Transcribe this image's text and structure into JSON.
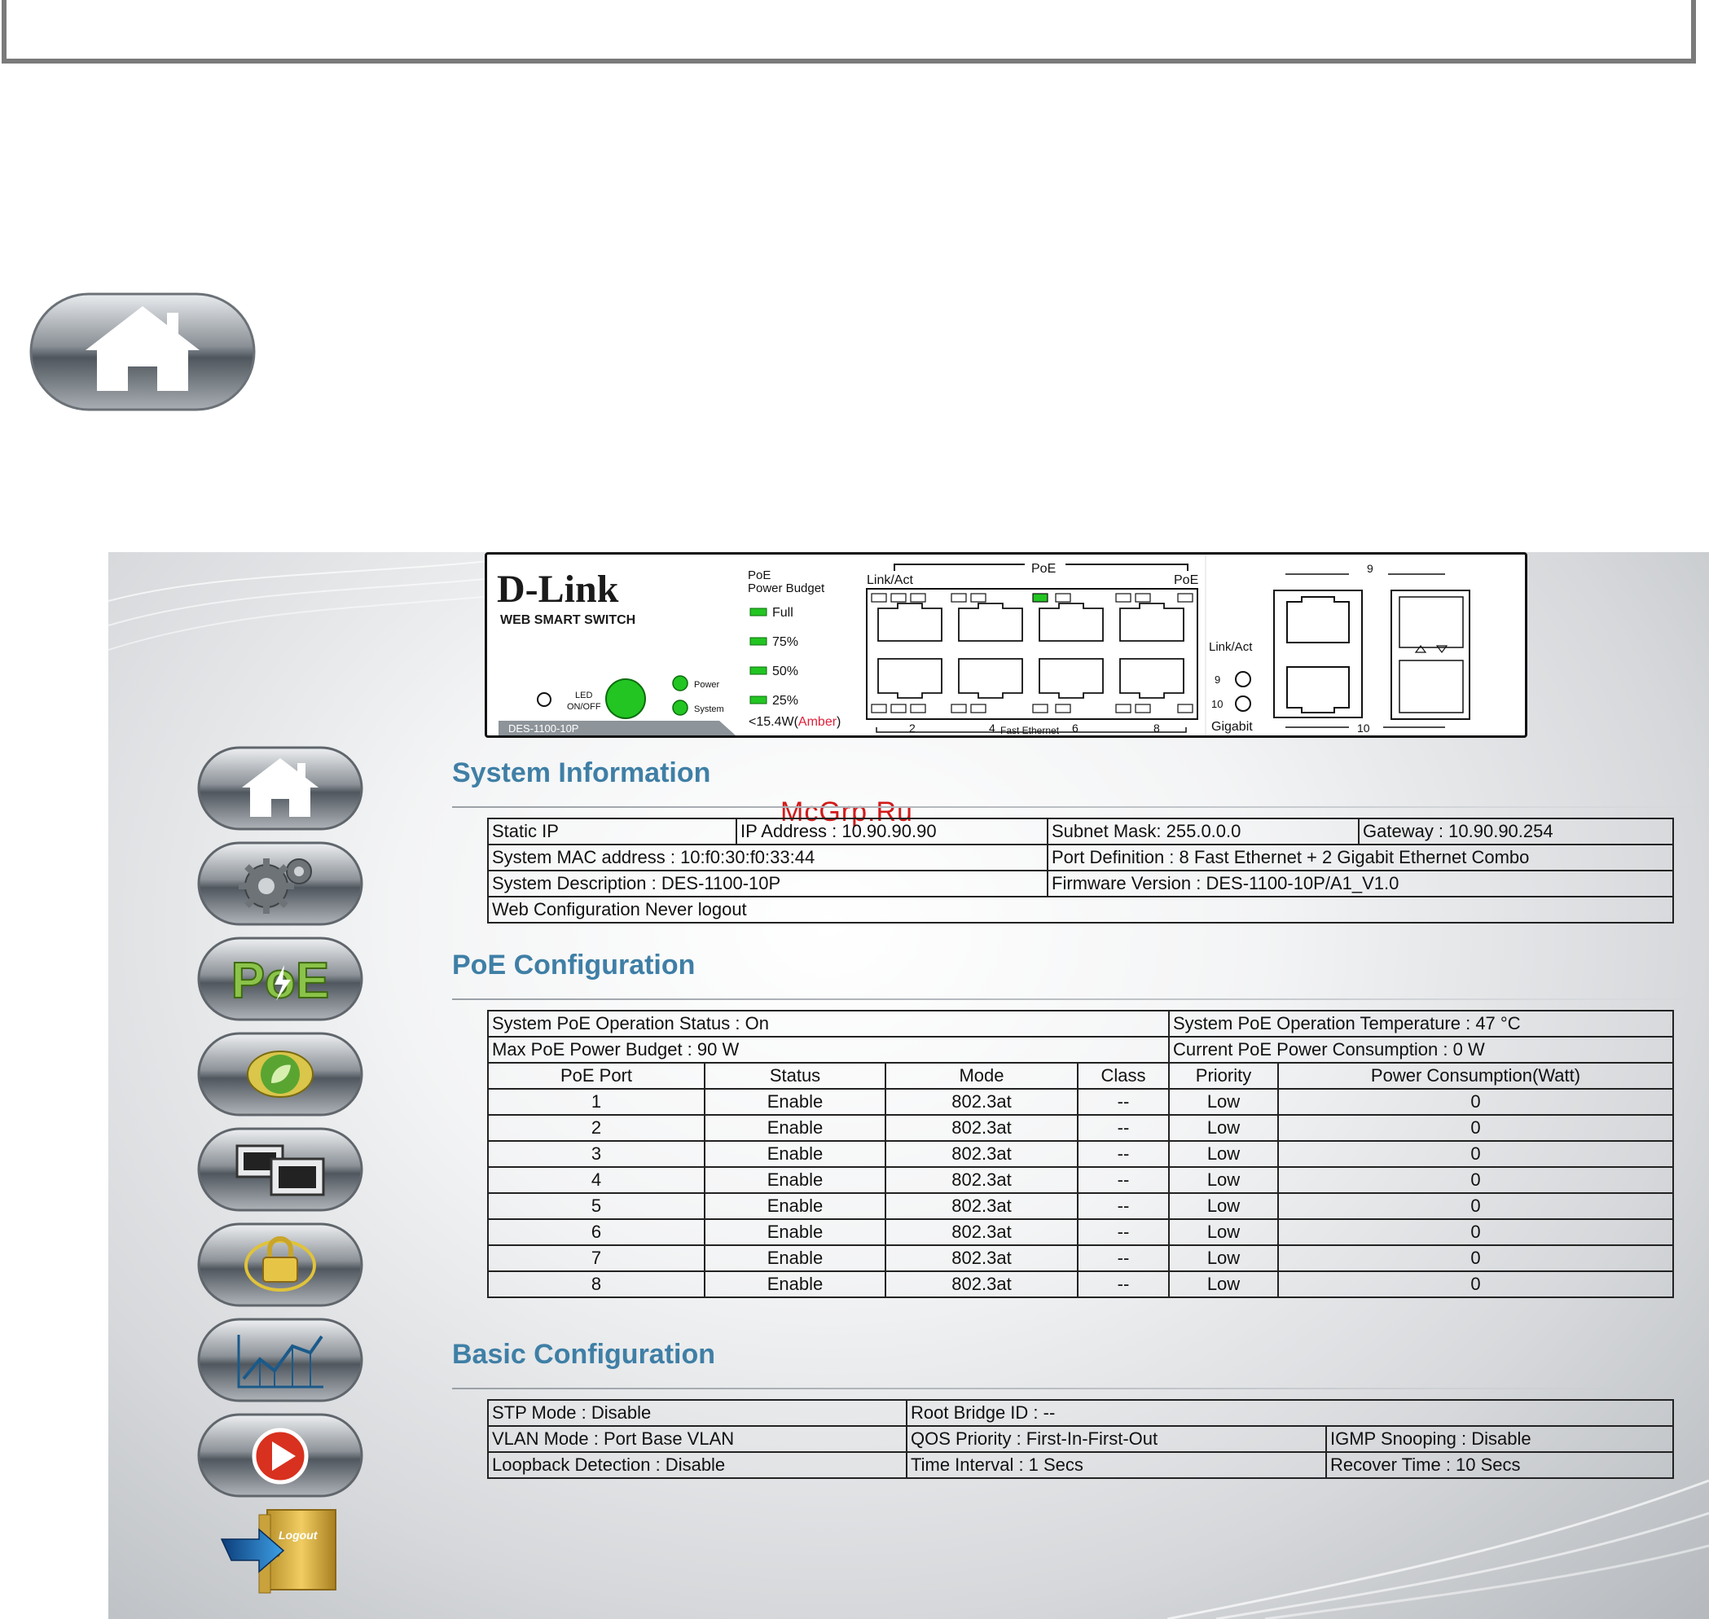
{
  "device": {
    "brand": "D-Link",
    "subtitle": "WEB SMART SWITCH",
    "model": "DES-1100-10P",
    "led_label_1": "LED",
    "led_label_2": "ON/OFF",
    "power_label": "Power",
    "system_label": "System",
    "poe_budget_label_1": "PoE",
    "poe_budget_label_2": "Power Budget",
    "budget_levels": [
      "Full",
      "75%",
      "50%",
      "25%"
    ],
    "budget_note": "<15.4W(",
    "budget_note_amber": "Amber",
    "budget_note_end": ")",
    "linkact_label": "Link/Act",
    "poe_label": "PoE",
    "poe_label_right": "PoE",
    "fast_ethernet_label": "Fast Ethernet",
    "port_numbers_bottom": [
      "2",
      "4",
      "6",
      "8"
    ],
    "gigabit_linkact": "Link/Act",
    "gigabit_led_9": "9",
    "gigabit_led_10": "10",
    "gigabit_label": "Gigabit",
    "combo_port_9": "9",
    "combo_port_10": "10",
    "active_poe_led_index": 2,
    "colors": {
      "led_green": "#22c522",
      "amber": "#e0203a"
    }
  },
  "sidebar": {
    "items": [
      {
        "name": "home",
        "icon": "home-icon"
      },
      {
        "name": "settings",
        "icon": "gears-icon"
      },
      {
        "name": "poe",
        "icon": "poe-icon"
      },
      {
        "name": "green",
        "icon": "leaf-icon"
      },
      {
        "name": "ports",
        "icon": "network-ports-icon"
      },
      {
        "name": "security",
        "icon": "lock-icon"
      },
      {
        "name": "monitoring",
        "icon": "chart-icon"
      },
      {
        "name": "tools",
        "icon": "play-icon"
      }
    ],
    "logout_label": "Logout"
  },
  "watermark": "McGrp.Ru",
  "system_info": {
    "title": "System Information",
    "static_ip": "Static IP",
    "ip_address": "IP Address : 10.90.90.90",
    "subnet_mask": "Subnet Mask: 255.0.0.0",
    "gateway": "Gateway : 10.90.90.254",
    "mac": "System MAC address : 10:f0:30:f0:33:44",
    "port_definition": "Port Definition : 8 Fast Ethernet + 2 Gigabit Ethernet Combo",
    "description": "System Description : DES-1100-10P",
    "firmware": "Firmware Version : DES-1100-10P/A1_V1.0",
    "web_config": "Web Configuration Never logout"
  },
  "poe_config": {
    "title": "PoE Configuration",
    "operation_status": "System PoE Operation Status : On",
    "temperature": "System PoE Operation Temperature : 47 °C",
    "max_budget": "Max PoE Power Budget : 90 W",
    "consumption": "Current PoE Power Consumption : 0 W",
    "headers": [
      "PoE Port",
      "Status",
      "Mode",
      "Class",
      "Priority",
      "Power Consumption(Watt)"
    ],
    "rows": [
      [
        "1",
        "Enable",
        "802.3at",
        "--",
        "Low",
        "0"
      ],
      [
        "2",
        "Enable",
        "802.3at",
        "--",
        "Low",
        "0"
      ],
      [
        "3",
        "Enable",
        "802.3at",
        "--",
        "Low",
        "0"
      ],
      [
        "4",
        "Enable",
        "802.3at",
        "--",
        "Low",
        "0"
      ],
      [
        "5",
        "Enable",
        "802.3at",
        "--",
        "Low",
        "0"
      ],
      [
        "6",
        "Enable",
        "802.3at",
        "--",
        "Low",
        "0"
      ],
      [
        "7",
        "Enable",
        "802.3at",
        "--",
        "Low",
        "0"
      ],
      [
        "8",
        "Enable",
        "802.3at",
        "--",
        "Low",
        "0"
      ]
    ]
  },
  "basic_config": {
    "title": "Basic Configuration",
    "stp_mode": "STP Mode : Disable",
    "root_bridge": "Root Bridge ID : --",
    "vlan_mode": "VLAN Mode : Port Base VLAN",
    "qos_priority": "QOS Priority : First-In-First-Out",
    "igmp_snooping": "IGMP Snooping : Disable",
    "loopback": "Loopback Detection : Disable",
    "time_interval": "Time Interval : 1 Secs",
    "recover_time": "Recover Time : 10 Secs"
  }
}
